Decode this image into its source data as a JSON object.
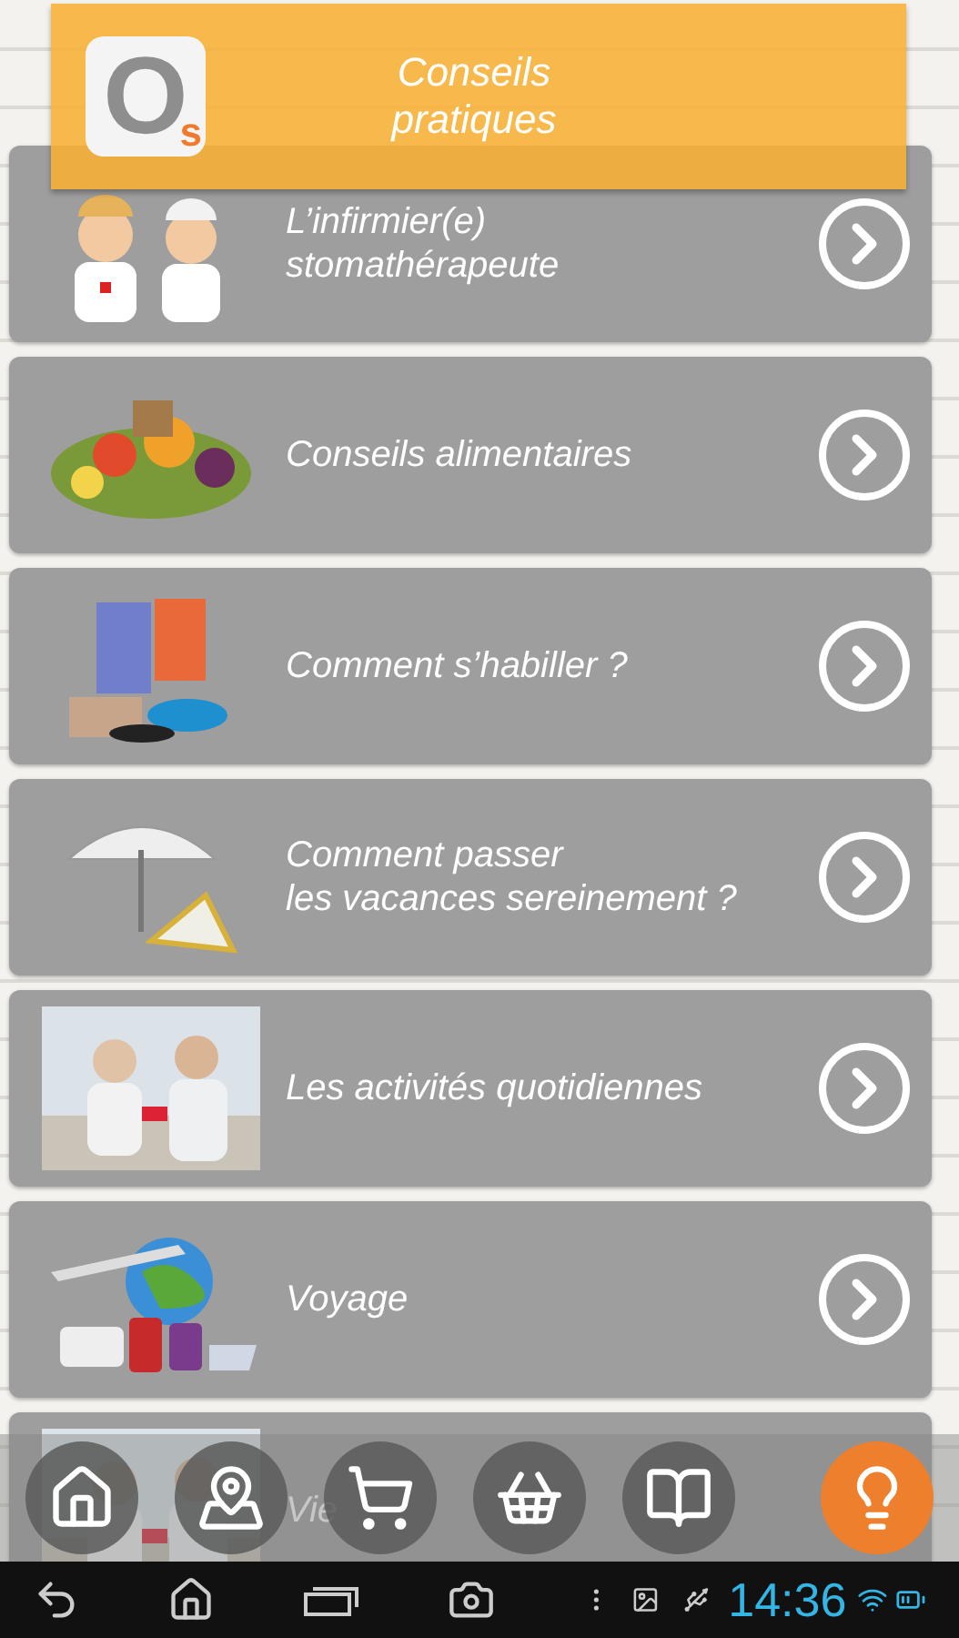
{
  "header": {
    "logo": {
      "letter": "O",
      "sub": "s"
    },
    "title": "Conseils pratiques"
  },
  "items": [
    {
      "title": "L’infirmier(e)\nstomathérapeute",
      "kind": "nurses",
      "arrow": true
    },
    {
      "title": "Conseils alimentaires",
      "kind": "food",
      "arrow": true
    },
    {
      "title": "Comment s’habiller ?",
      "kind": "clothes",
      "arrow": true
    },
    {
      "title": "Comment passer\nles vacances sereinement ?",
      "kind": "beach",
      "arrow": true
    },
    {
      "title": "Les activités quotidiennes",
      "arrow": true
    },
    {
      "title": "Voyage",
      "kind": "travel",
      "arrow": true
    },
    {
      "title": "Vie",
      "arrow": false
    }
  ],
  "nav": [
    {
      "kind": "home",
      "selected": false
    },
    {
      "kind": "map",
      "selected": false
    },
    {
      "kind": "cart",
      "selected": false
    },
    {
      "kind": "basket",
      "selected": false
    },
    {
      "kind": "book",
      "selected": false
    },
    {
      "kind": "bulb",
      "selected": true
    }
  ],
  "status_bar": {
    "time": "14:36"
  }
}
